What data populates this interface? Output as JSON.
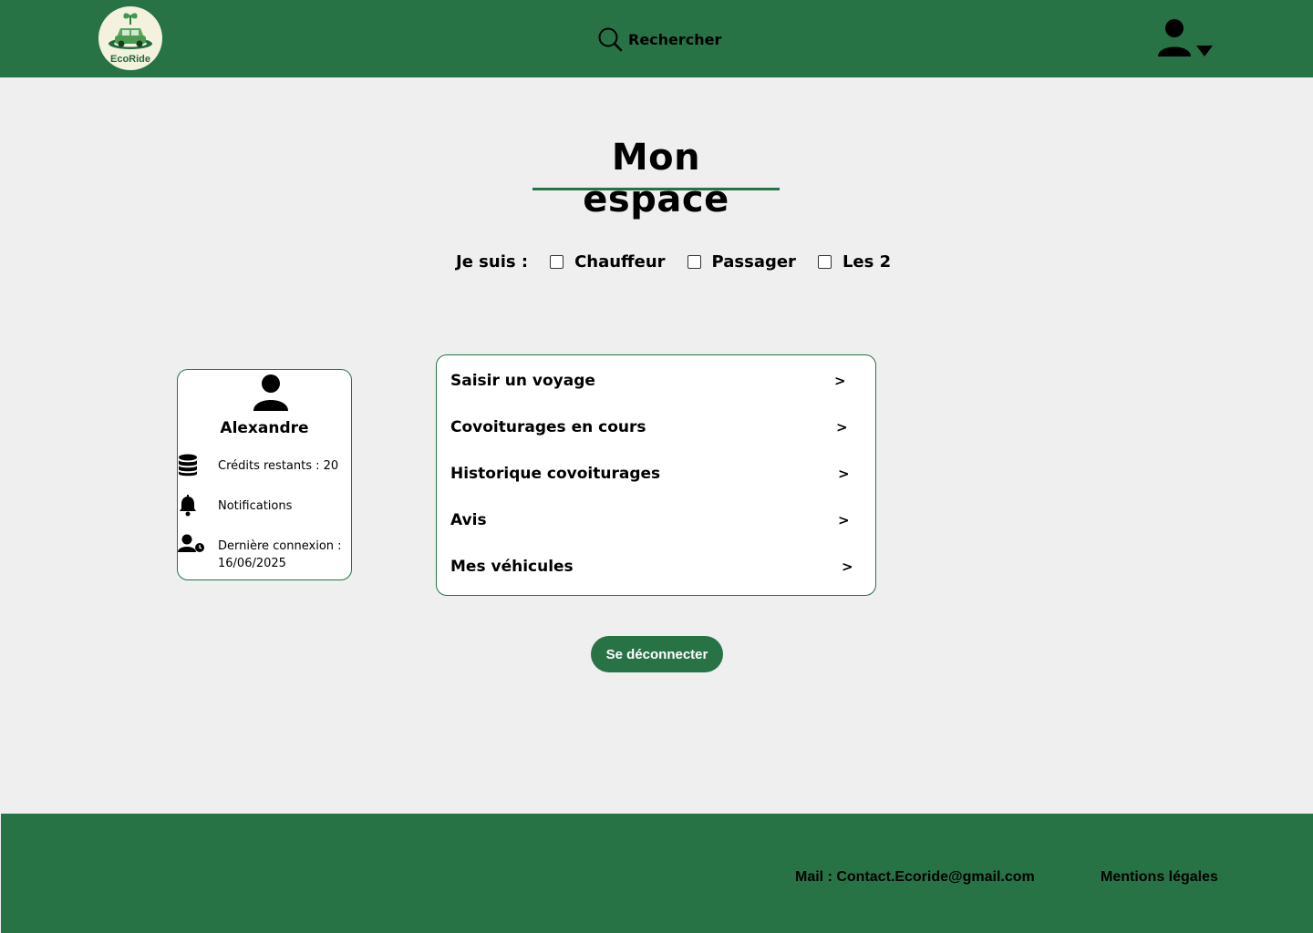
{
  "header": {
    "logo_text": "EcoRide",
    "search_label": "Rechercher"
  },
  "page": {
    "title": "Mon espace"
  },
  "roles": {
    "prompt": "Je suis :",
    "options": [
      "Chauffeur",
      "Passager",
      "Les 2"
    ]
  },
  "profile": {
    "name": "Alexandre",
    "credits": "Crédits restants : 20",
    "notifications": "Notifications",
    "last_login_label": "Dernière connexion :",
    "last_login_date": "16/06/2025"
  },
  "menu": {
    "items": [
      {
        "label": "Saisir un voyage",
        "chevron": ">"
      },
      {
        "label": "Covoiturages en cours",
        "chevron": ">"
      },
      {
        "label": "Historique covoiturages",
        "chevron": ">"
      },
      {
        "label": "Avis",
        "chevron": ">"
      },
      {
        "label": "Mes véhicules",
        "chevron": ">"
      }
    ]
  },
  "actions": {
    "logout_label": "Se déconnecter"
  },
  "footer": {
    "mail": "Mail : Contact.Ecoride@gmail.com",
    "legal": "Mentions légales"
  },
  "colors": {
    "brand_green": "#277345",
    "background": "#efefef"
  },
  "icons": [
    "search-icon",
    "user-icon",
    "dropdown-caret-icon",
    "coins-icon",
    "bell-icon",
    "user-clock-icon"
  ]
}
